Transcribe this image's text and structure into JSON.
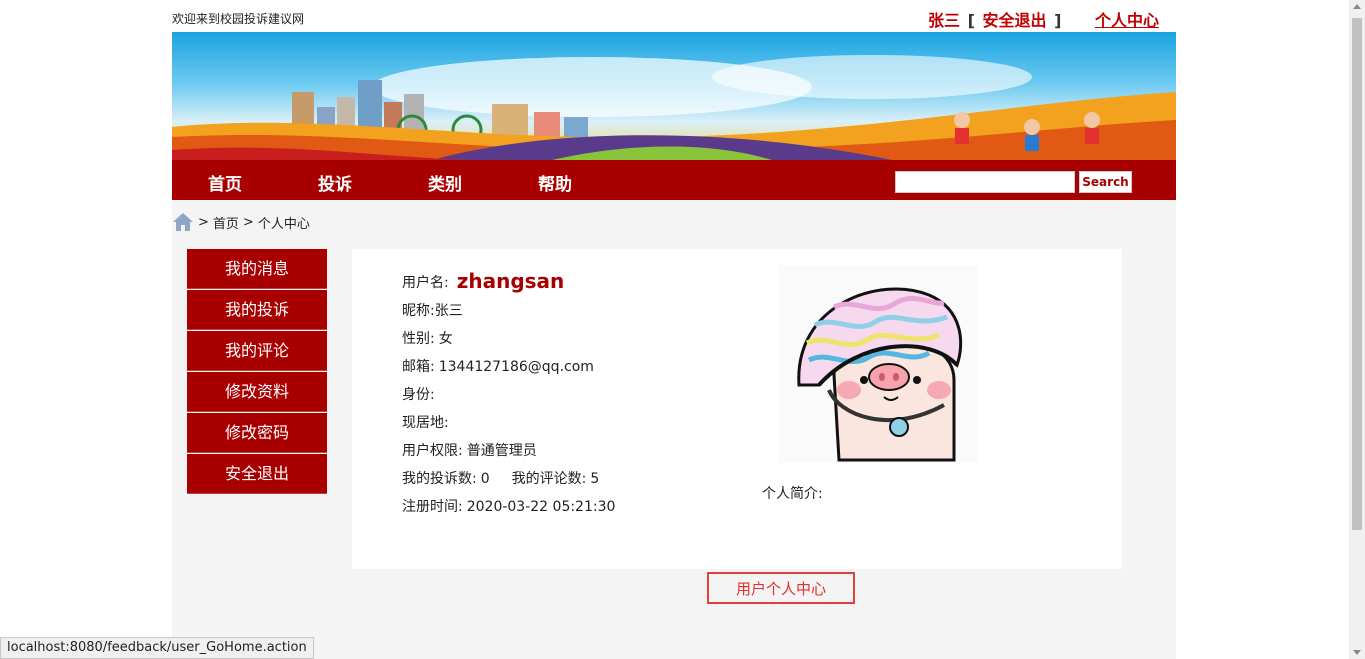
{
  "top": {
    "welcome": "欢迎来到校园投诉建议网",
    "username": "张三",
    "bracket_open": "[",
    "logout": "安全退出",
    "bracket_close": "]",
    "personal_center": "个人中心"
  },
  "nav": {
    "items": [
      "首页",
      "投诉",
      "类别",
      "帮助"
    ],
    "search_value": "",
    "search_button": "Search"
  },
  "breadcrumb": {
    "sep1": ">",
    "home": "首页",
    "sep2": ">",
    "current": "个人中心"
  },
  "sidebar": {
    "items": [
      "我的消息",
      "我的投诉",
      "我的评论",
      "修改资料",
      "修改密码",
      "安全退出"
    ]
  },
  "profile": {
    "username_label": "用户名:",
    "username": "zhangsan",
    "nickname_label": "昵称:",
    "nickname": "张三",
    "gender_label": "性别:",
    "gender": "女",
    "email_label": "邮箱:",
    "email": "1344127186@qq.com",
    "identity_label": "身份:",
    "identity": "",
    "residence_label": "现居地:",
    "residence": "",
    "permission_label": "用户权限:",
    "permission": "普通管理员",
    "complaints_label": "我的投诉数:",
    "complaints": "0",
    "comments_label": "我的评论数:",
    "comments": "5",
    "registered_label": "注册时间:",
    "registered": "2020-03-22 05:21:30",
    "intro_label": "个人简介:",
    "intro": ""
  },
  "footer": {
    "button": "用户个人中心"
  },
  "statusbar": {
    "url": "localhost:8080/feedback/user_GoHome.action"
  },
  "colors": {
    "brand": "#a80000",
    "accent_red": "#c00000",
    "footer_border": "#e04040"
  }
}
